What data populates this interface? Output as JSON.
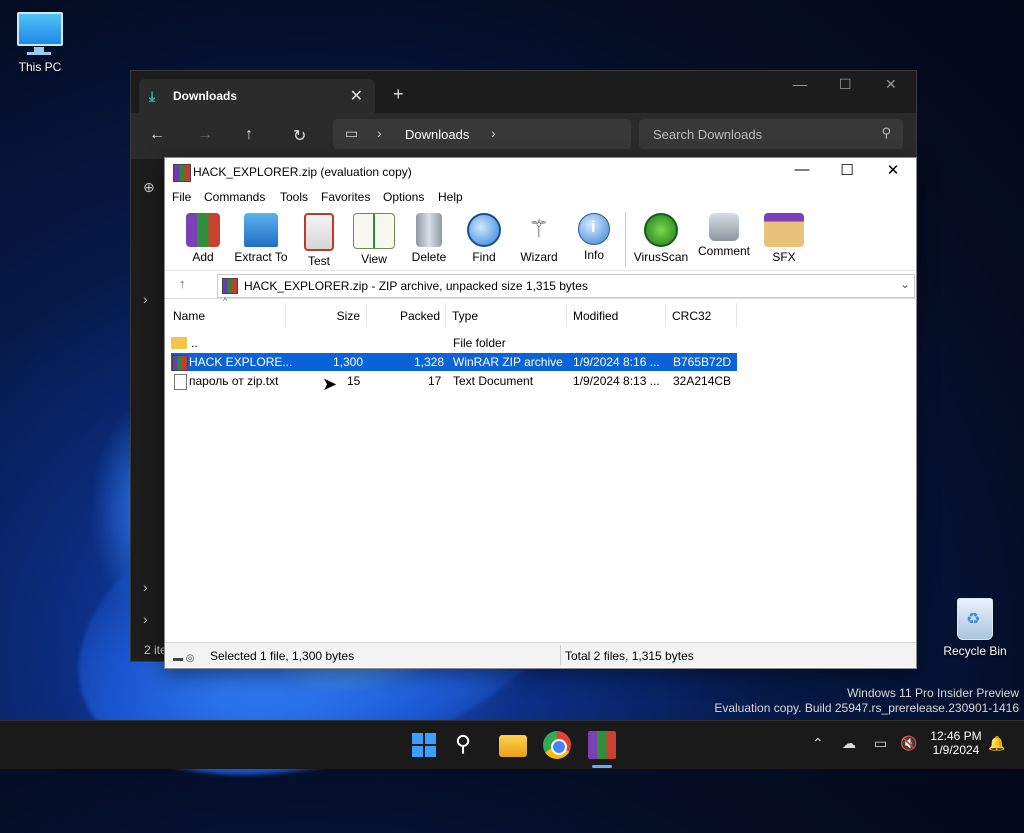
{
  "desktop": {
    "icons": [
      {
        "label": "This PC"
      },
      {
        "label": "Recycle Bin"
      }
    ],
    "watermark": {
      "line1": "Windows 11 Pro Insider Preview",
      "line2": "Evaluation copy. Build 25947.rs_prerelease.230901-1416"
    }
  },
  "explorer": {
    "tab_label": "Downloads",
    "address_label": "Downloads",
    "search_placeholder": "Search Downloads",
    "status_partial": "2 ite"
  },
  "winrar": {
    "title": "HACK_EXPLORER.zip (evaluation copy)",
    "menu": [
      "File",
      "Commands",
      "Tools",
      "Favorites",
      "Options",
      "Help"
    ],
    "toolbar": [
      {
        "label": "Add",
        "icon": "add-books-icon"
      },
      {
        "label": "Extract To",
        "icon": "extract-folder-icon"
      },
      {
        "label": "Test",
        "icon": "test-clipboard-icon"
      },
      {
        "label": "View",
        "icon": "book-view-icon"
      },
      {
        "label": "Delete",
        "icon": "trash-icon"
      },
      {
        "label": "Find",
        "icon": "magnifier-icon"
      },
      {
        "label": "Wizard",
        "icon": "wand-icon"
      },
      {
        "label": "Info",
        "icon": "info-icon"
      },
      {
        "label": "VirusScan",
        "icon": "bug-icon"
      },
      {
        "label": "Comment",
        "icon": "comment-icon"
      },
      {
        "label": "SFX",
        "icon": "sfx-box-icon"
      }
    ],
    "path_text": "HACK_EXPLORER.zip - ZIP archive, unpacked size 1,315 bytes",
    "columns": [
      "Name",
      "Size",
      "Packed",
      "Type",
      "Modified",
      "CRC32"
    ],
    "rows": [
      {
        "name": "..",
        "size": "",
        "packed": "",
        "type": "File folder",
        "modified": "",
        "crc": ""
      },
      {
        "name": "HACK EXPLORE...",
        "size": "1,300",
        "packed": "1,328",
        "type": "WinRAR ZIP archive",
        "modified": "1/9/2024 8:16 ...",
        "crc": "B765B72D"
      },
      {
        "name": "пароль от zip.txt",
        "size": "15",
        "packed": "17",
        "type": "Text Document",
        "modified": "1/9/2024 8:13 ...",
        "crc": "32A214CB"
      }
    ],
    "status_left": "Selected 1 file, 1,300 bytes",
    "status_right": "Total 2 files, 1,315 bytes"
  },
  "taskbar": {
    "time": "12:46 PM",
    "date": "1/9/2024"
  },
  "colors": {
    "selection": "#0a64d8",
    "explorer_dark": "#202020",
    "taskbar": "#1a1a1a"
  }
}
